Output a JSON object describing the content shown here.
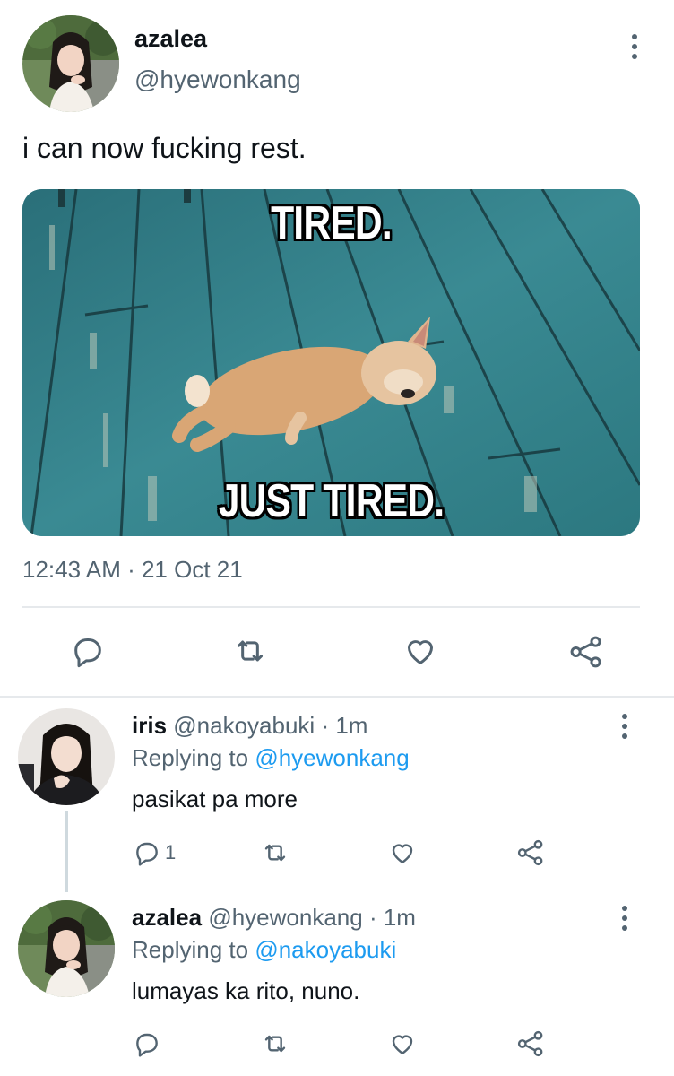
{
  "tweet": {
    "display_name": "azalea",
    "handle": "@hyewonkang",
    "text": "i can now fucking rest.",
    "meme_top": "TIRED.",
    "meme_bottom": "JUST TIRED.",
    "timestamp": "12:43 AM · 21 Oct 21"
  },
  "reply1": {
    "display_name": "iris",
    "handle": "@nakoyabuki",
    "time": "· 1m",
    "replying_prefix": "Replying to",
    "replying_to": "@hyewonkang",
    "text": "pasikat pa more",
    "reply_count": "1"
  },
  "reply2": {
    "display_name": "azalea",
    "handle": "@hyewonkang",
    "time": "· 1m",
    "replying_prefix": "Replying to",
    "replying_to": "@nakoyabuki",
    "text": "lumayas ka rito, nuno."
  },
  "icons": {
    "reply": "reply-icon",
    "retweet": "retweet-icon",
    "like": "heart-icon",
    "share": "share-icon",
    "more": "more-vertical-icon"
  },
  "colors": {
    "text": "#0f1419",
    "muted": "#536471",
    "link": "#1d9bf0",
    "divider": "#e6e9ec"
  }
}
